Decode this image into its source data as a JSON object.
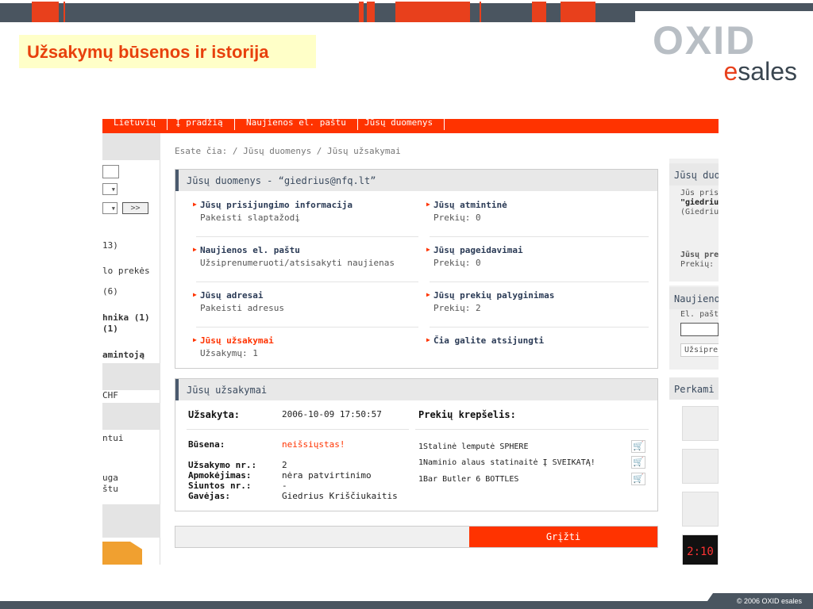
{
  "slide": {
    "title": "Užsakymų būsenos ir istorija",
    "logo_top": "OXID",
    "logo_e": "e",
    "logo_rest": "sales",
    "copyright": "© 2006 OXID esales"
  },
  "nav": {
    "items": [
      "Lietuvių",
      "Į pradžią",
      "Naujienos el. paštu",
      "Jūsų duomenys"
    ]
  },
  "left": {
    "go_button": ">>",
    "items": [
      "13)",
      "lo prekės",
      "(6)",
      "hnika (1)",
      "(1)",
      "amintoją",
      "CHF",
      "ntui",
      "uga",
      "štu"
    ]
  },
  "breadcrumb": "Esate čia: / Jūsų duomenys / Jūsų užsakymai",
  "account": {
    "heading": "Jūsų duomenys - “giedrius@nfq.lt”",
    "cells": [
      {
        "title": "Jūsų prisijungimo informacija",
        "sub": "Pakeisti slaptažodį"
      },
      {
        "title": "Jūsų atmintinė",
        "sub": "Prekių: 0"
      },
      {
        "title": "Naujienos el. paštu",
        "sub": "Užsiprenumeruoti/atsisakyti naujienas"
      },
      {
        "title": "Jūsų pageidavimai",
        "sub": "Prekių: 0"
      },
      {
        "title": "Jūsų adresai",
        "sub": "Pakeisti adresus"
      },
      {
        "title": "Jūsų prekių palyginimas",
        "sub": "Prekių: 2"
      },
      {
        "title": "Jūsų užsakymai",
        "sub": "Užsakymų: 1"
      },
      {
        "title": "Čia galite atsijungti",
        "sub": ""
      }
    ]
  },
  "orders": {
    "heading": "Jūsų užsakymai",
    "ordered_label": "Užsakyta:",
    "ordered_value": "2006-10-09 17:50:57",
    "basket_label": "Prekių krepšelis:",
    "status_label": "Būsena:",
    "status_value": "neišsiųstas!",
    "order_no_label": "Užsakymo nr.:",
    "order_no_value": "2",
    "payment_label": "Apmokėjimas:",
    "payment_value": "nėra patvirtinimo",
    "shipment_label": "Siuntos nr.:",
    "shipment_value": "-",
    "recipient_label": "Gavėjas:",
    "recipient_value": "Giedrius Kriščiukaitis",
    "products": [
      "1Stalinė lemputė SPHERE",
      "1Naminio alaus statinaitė Į SVEIKATĄ!",
      "1Bar Butler 6 BOTTLES"
    ],
    "cart_icon": "🛒"
  },
  "back_button": "Grįžti",
  "right": {
    "box1_head": "Jūsų duo",
    "box1_line1": "Jūs prisi",
    "box1_line2": "\"giedriu",
    "box1_line3": "(Giedriu",
    "box1_line4": "Jūsų pre",
    "box1_line5": "Prekių:",
    "box2_head": "Naujieno",
    "box2_line1": "El. pašto",
    "box2_button": "Užsipre",
    "box3_head": "Perkami",
    "clock_text": "2:10"
  },
  "colors": {
    "accent": "#ff3300",
    "title_bg": "#ffffc8",
    "dark": "#4a5560"
  }
}
